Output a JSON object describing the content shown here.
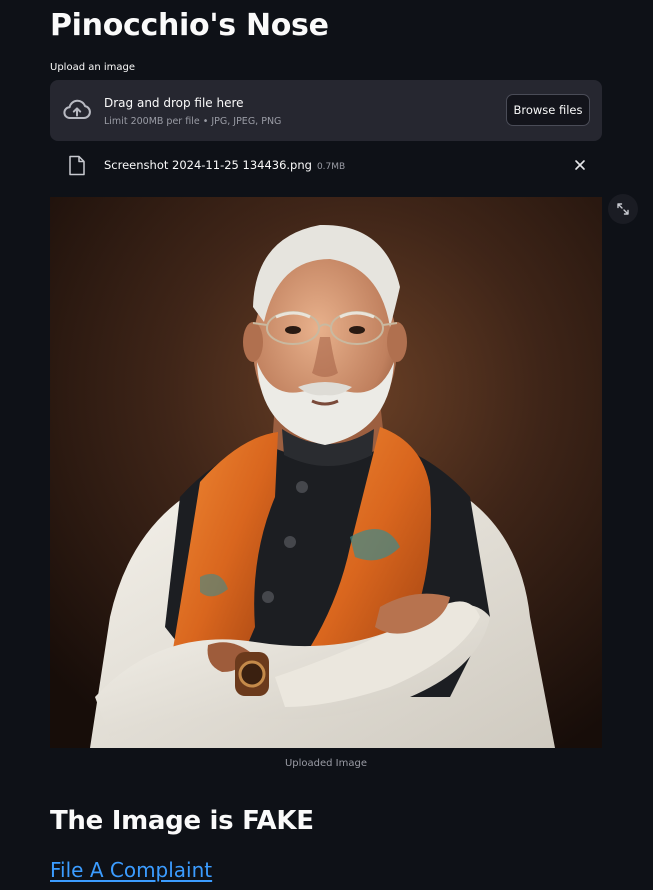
{
  "app": {
    "title": "Pinocchio's Nose"
  },
  "uploader": {
    "label": "Upload an image",
    "drop_text": "Drag and drop file here",
    "limit_text": "Limit 200MB per file • JPG, JPEG, PNG",
    "browse_label": "Browse files",
    "icon": "cloud-upload-icon"
  },
  "uploaded_file": {
    "name": "Screenshot 2024-11-25 134436.png",
    "size": "0.7MB",
    "icon": "file-icon",
    "remove_icon": "close-icon"
  },
  "image": {
    "caption": "Uploaded Image",
    "fullscreen_icon": "expand-icon"
  },
  "result": {
    "verdict": "The Image is FAKE"
  },
  "actions": {
    "complaint_link": "File A Complaint"
  },
  "colors": {
    "background": "#0e1117",
    "panel": "#262730",
    "link": "#3b9cff",
    "muted_text": "#9a9ca5",
    "scarf_orange": "#d9661e"
  }
}
